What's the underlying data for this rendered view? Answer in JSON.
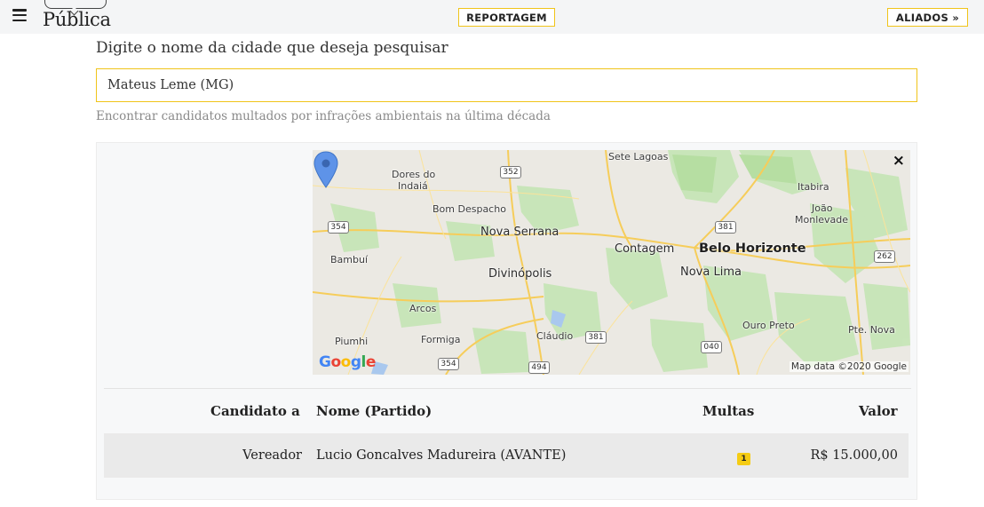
{
  "header": {
    "logo_text": "Pública",
    "reportagem_label": "REPORTAGEM",
    "aliados_label": "ALIADOS »"
  },
  "search": {
    "label": "Digite o nome da cidade que deseja pesquisar",
    "value": "Mateus Leme (MG)",
    "hint": "Encontrar candidatos multados por infrações ambientais na última década"
  },
  "map": {
    "close_glyph": "×",
    "attribution": "Map data ©2020 Google",
    "provider": "Google",
    "places": {
      "sete_lagoas": "Sete Lagoas",
      "dores_do_indaia_1": "Dores do",
      "dores_do_indaia_2": "Indaiá",
      "bom_despacho": "Bom Despacho",
      "nova_serrana": "Nova Serrana",
      "divinopolis": "Divinópolis",
      "contagem": "Contagem",
      "belo_horizonte": "Belo Horizonte",
      "nova_lima": "Nova Lima",
      "itabira": "Itabira",
      "joao_monlevade_1": "João",
      "joao_monlevade_2": "Monlevade",
      "bambui": "Bambuí",
      "arcos": "Arcos",
      "piumhi": "Piumhi",
      "formiga": "Formiga",
      "claudio": "Cláudio",
      "ouro_preto": "Ouro Preto",
      "pte_nova": "Pte. Nova"
    },
    "shields": {
      "r352": "352",
      "r354a": "354",
      "r381a": "381",
      "r262": "262",
      "r381b": "381",
      "r354b": "354",
      "r494": "494",
      "r040": "040"
    }
  },
  "table": {
    "headers": {
      "candidato": "Candidato a",
      "nome": "Nome (Partido)",
      "multas": "Multas",
      "valor": "Valor"
    },
    "rows": [
      {
        "candidato": "Vereador",
        "nome": "Lucio Goncalves Madureira (AVANTE)",
        "multas": "1",
        "valor": "R$ 15.000,00"
      }
    ]
  },
  "colors": {
    "accent": "#f0c419",
    "badge": "#f5cc14",
    "pin": "#5e93e8"
  }
}
